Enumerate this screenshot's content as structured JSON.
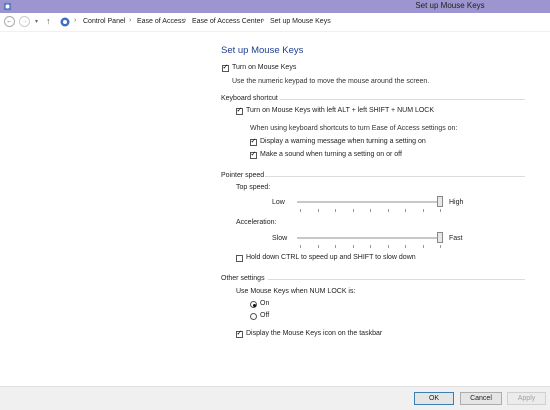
{
  "window": {
    "title": "Set up Mouse Keys"
  },
  "breadcrumb": [
    "Control Panel",
    "Ease of Access",
    "Ease of Access Center",
    "Set up Mouse Keys"
  ],
  "page": {
    "heading": "Set up Mouse Keys",
    "turn_on": {
      "label": "Turn on Mouse Keys",
      "checked": true,
      "description": "Use the numeric keypad to move the mouse around the screen."
    },
    "keyboard_shortcut": {
      "label": "Keyboard shortcut",
      "shortcut_option": {
        "label": "Turn on Mouse Keys with left ALT + left SHIFT + NUM LOCK",
        "checked": true
      },
      "note": "When using keyboard shortcuts to turn Ease of Access settings on:",
      "warning_option": {
        "label": "Display a warning message when turning a setting on",
        "checked": true
      },
      "sound_option": {
        "label": "Make a sound when turning a setting on or off",
        "checked": true
      }
    },
    "pointer_speed": {
      "label": "Pointer speed",
      "top_speed": {
        "label": "Top speed:",
        "min_label": "Low",
        "max_label": "High",
        "value": 1.0
      },
      "acceleration": {
        "label": "Acceleration:",
        "min_label": "Slow",
        "max_label": "Fast",
        "value": 1.0
      },
      "ctrl_shift_option": {
        "label": "Hold down CTRL to speed up and SHIFT to slow down",
        "checked": false
      }
    },
    "other_settings": {
      "label": "Other settings",
      "numlock_label": "Use Mouse Keys when NUM LOCK is:",
      "on_label": "On",
      "off_label": "Off",
      "selected": "On",
      "taskbar_option": {
        "label": "Display the Mouse Keys icon on the taskbar",
        "checked": true
      }
    }
  },
  "buttons": {
    "ok": "OK",
    "cancel": "Cancel",
    "apply": "Apply"
  }
}
